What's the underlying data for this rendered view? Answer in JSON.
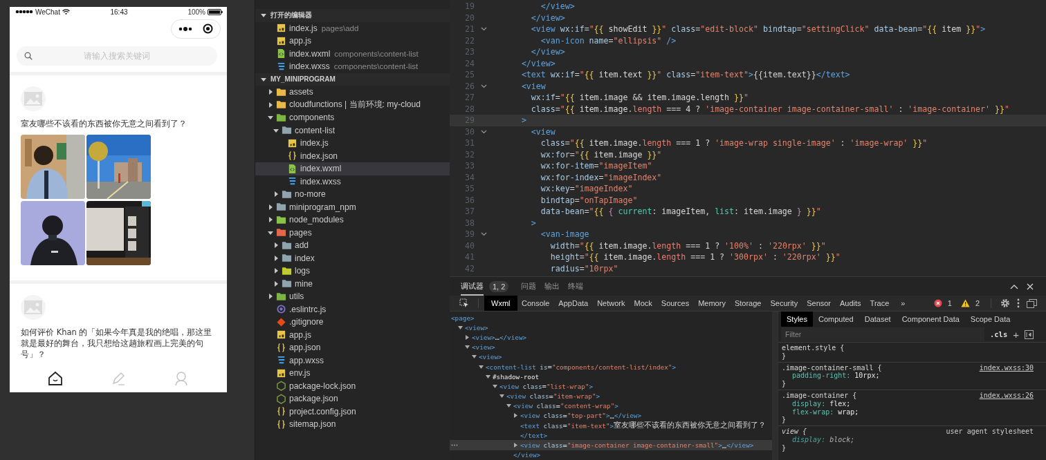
{
  "simulator": {
    "status_bar": {
      "carrier": "WeChat",
      "time": "16:43",
      "battery": "100%"
    },
    "search": {
      "placeholder": "请输入搜索关键词"
    },
    "posts": [
      {
        "text": "室友哪些不该看的东西被你无意之间看到了？"
      },
      {
        "text": "如何评价 Khan 的「如果今年真是我的绝唱，那这里就是最好的舞台，我只想给这趟旅程画上完美的句号」？"
      }
    ],
    "tab_bar": [
      {
        "selected": true
      },
      {
        "selected": false
      },
      {
        "selected": false
      }
    ]
  },
  "explorer": {
    "sections": [
      {
        "title": "打开的编辑器",
        "expanded": true,
        "items": [
          {
            "name": "index.js",
            "path": "pages\\add",
            "kind": "js"
          },
          {
            "name": "app.js",
            "kind": "js"
          },
          {
            "name": "index.wxml",
            "path": "components\\content-list",
            "kind": "wxml"
          },
          {
            "name": "index.wxss",
            "path": "components\\content-list",
            "kind": "wxss"
          }
        ]
      },
      {
        "title": "MY_MINIPROGRAM",
        "expanded": true,
        "items": [
          {
            "name": "assets",
            "kind": "folder",
            "color": "#e8b948",
            "expanded": false,
            "selected": false
          },
          {
            "name": "cloudfunctions | 当前环境: my-cloud",
            "kind": "folder",
            "color": "#e8b948",
            "expanded": false,
            "selected": false
          },
          {
            "name": "components",
            "kind": "folder",
            "color": "#7cb342",
            "expanded": true,
            "selected": false,
            "children": [
              {
                "name": "content-list",
                "kind": "folder",
                "color": "#90a4ae",
                "expanded": true,
                "selected": false,
                "children": [
                  {
                    "name": "index.js",
                    "kind": "js",
                    "selected": false
                  },
                  {
                    "name": "index.json",
                    "kind": "json",
                    "selected": false
                  },
                  {
                    "name": "index.wxml",
                    "kind": "wxml",
                    "selected": true
                  },
                  {
                    "name": "index.wxss",
                    "kind": "wxss",
                    "selected": false
                  }
                ]
              },
              {
                "name": "no-more",
                "kind": "folder",
                "color": "#90a4ae",
                "expanded": false,
                "selected": false
              }
            ]
          },
          {
            "name": "miniprogram_npm",
            "kind": "folder",
            "color": "#90a4ae",
            "expanded": false,
            "selected": false
          },
          {
            "name": "node_modules",
            "kind": "folder",
            "color": "#8bc34a",
            "expanded": false,
            "selected": false
          },
          {
            "name": "pages",
            "kind": "folder",
            "color": "#e5674a",
            "expanded": true,
            "selected": false,
            "children": [
              {
                "name": "add",
                "kind": "folder",
                "color": "#90a4ae",
                "expanded": false,
                "selected": false
              },
              {
                "name": "index",
                "kind": "folder",
                "color": "#90a4ae",
                "expanded": false,
                "selected": false
              },
              {
                "name": "logs",
                "kind": "folder",
                "color": "#c0ca33",
                "expanded": false,
                "selected": false
              },
              {
                "name": "mine",
                "kind": "folder",
                "color": "#90a4ae",
                "expanded": false,
                "selected": false
              }
            ]
          },
          {
            "name": "utils",
            "kind": "folder",
            "color": "#7cb342",
            "expanded": false,
            "selected": false
          },
          {
            "name": ".eslintrc.js",
            "kind": "eslint",
            "selected": false
          },
          {
            "name": ".gitignore",
            "kind": "git",
            "selected": false
          },
          {
            "name": "app.js",
            "kind": "js",
            "selected": false
          },
          {
            "name": "app.json",
            "kind": "json",
            "selected": false
          },
          {
            "name": "app.wxss",
            "kind": "wxss",
            "selected": false
          },
          {
            "name": "env.js",
            "kind": "js",
            "selected": false
          },
          {
            "name": "package-lock.json",
            "kind": "npm",
            "selected": false
          },
          {
            "name": "package.json",
            "kind": "npm",
            "selected": false
          },
          {
            "name": "project.config.json",
            "kind": "json",
            "selected": false
          },
          {
            "name": "sitemap.json",
            "kind": "json",
            "selected": false
          }
        ]
      }
    ]
  },
  "editor": {
    "lines": [
      {
        "number": "19",
        "foldable": false,
        "active": false,
        "tokens": [
          {
            "kind": "tag",
            "text": "          </view>"
          }
        ]
      },
      {
        "number": "20",
        "foldable": false,
        "active": false,
        "tokens": [
          {
            "kind": "tag",
            "text": "        </view>"
          }
        ]
      },
      {
        "number": "21",
        "foldable": true,
        "active": false,
        "tokens": [
          {
            "kind": "tag",
            "text": "        <view"
          },
          {
            "kind": "attr",
            "text": " wx:if"
          },
          {
            "kind": "plain",
            "text": "="
          },
          {
            "kind": "str",
            "text": "\""
          },
          {
            "kind": "brace",
            "text": "{{"
          },
          {
            "kind": "var",
            "text": " showEdit "
          },
          {
            "kind": "brace",
            "text": "}}"
          },
          {
            "kind": "str",
            "text": "\""
          },
          {
            "kind": "attr",
            "text": " class"
          },
          {
            "kind": "plain",
            "text": "="
          },
          {
            "kind": "str",
            "text": "\"edit-block\""
          },
          {
            "kind": "attr",
            "text": " bindtap"
          },
          {
            "kind": "plain",
            "text": "="
          },
          {
            "kind": "str",
            "text": "\"settingClick\""
          },
          {
            "kind": "attr",
            "text": " data-bean"
          },
          {
            "kind": "plain",
            "text": "="
          },
          {
            "kind": "str",
            "text": "\""
          },
          {
            "kind": "brace",
            "text": "{{"
          },
          {
            "kind": "var",
            "text": " item "
          },
          {
            "kind": "brace",
            "text": "}}"
          },
          {
            "kind": "str",
            "text": "\""
          },
          {
            "kind": "tag",
            "text": ">"
          }
        ]
      },
      {
        "number": "22",
        "foldable": false,
        "active": false,
        "tokens": [
          {
            "kind": "tag",
            "text": "          <van-icon"
          },
          {
            "kind": "attr",
            "text": " name"
          },
          {
            "kind": "plain",
            "text": "="
          },
          {
            "kind": "str",
            "text": "\"ellipsis\""
          },
          {
            "kind": "tag",
            "text": " />"
          }
        ]
      },
      {
        "number": "23",
        "foldable": false,
        "active": false,
        "tokens": [
          {
            "kind": "tag",
            "text": "        </view>"
          }
        ]
      },
      {
        "number": "24",
        "foldable": false,
        "active": false,
        "tokens": [
          {
            "kind": "tag",
            "text": "      </view>"
          }
        ]
      },
      {
        "number": "25",
        "foldable": false,
        "active": false,
        "tokens": [
          {
            "kind": "tag",
            "text": "      <text"
          },
          {
            "kind": "attr",
            "text": " wx:if"
          },
          {
            "kind": "plain",
            "text": "="
          },
          {
            "kind": "str",
            "text": "\""
          },
          {
            "kind": "brace",
            "text": "{{"
          },
          {
            "kind": "var",
            "text": " item.text "
          },
          {
            "kind": "brace",
            "text": "}}"
          },
          {
            "kind": "str",
            "text": "\""
          },
          {
            "kind": "attr",
            "text": " class"
          },
          {
            "kind": "plain",
            "text": "="
          },
          {
            "kind": "str",
            "text": "\"item-text\""
          },
          {
            "kind": "tag",
            "text": ">"
          },
          {
            "kind": "plain",
            "text": "{{item.text}}"
          },
          {
            "kind": "tag",
            "text": "</text>"
          }
        ]
      },
      {
        "number": "26",
        "foldable": true,
        "active": false,
        "tokens": [
          {
            "kind": "tag",
            "text": "      <view"
          }
        ]
      },
      {
        "number": "27",
        "foldable": false,
        "active": false,
        "tokens": [
          {
            "kind": "attr",
            "text": "        wx:if"
          },
          {
            "kind": "plain",
            "text": "="
          },
          {
            "kind": "str",
            "text": "\""
          },
          {
            "kind": "brace",
            "text": "{{"
          },
          {
            "kind": "var",
            "text": " item.image && item.image.length "
          },
          {
            "kind": "brace",
            "text": "}}"
          },
          {
            "kind": "str",
            "text": "\""
          }
        ]
      },
      {
        "number": "28",
        "foldable": false,
        "active": false,
        "tokens": [
          {
            "kind": "attr",
            "text": "        class"
          },
          {
            "kind": "plain",
            "text": "="
          },
          {
            "kind": "str",
            "text": "\""
          },
          {
            "kind": "brace",
            "text": "{{"
          },
          {
            "kind": "var",
            "text": " item.image."
          },
          {
            "kind": "prop",
            "text": "length"
          },
          {
            "kind": "var",
            "text": " === 4 ? "
          },
          {
            "kind": "str",
            "text": "'image-container image-container-small'"
          },
          {
            "kind": "var",
            "text": " : "
          },
          {
            "kind": "str",
            "text": "'image-container'"
          },
          {
            "kind": "brace",
            "text": " }}"
          },
          {
            "kind": "str",
            "text": "\""
          }
        ]
      },
      {
        "number": "29",
        "foldable": false,
        "active": true,
        "tokens": [
          {
            "kind": "tag",
            "text": "      >"
          }
        ]
      },
      {
        "number": "30",
        "foldable": true,
        "active": false,
        "tokens": [
          {
            "kind": "tag",
            "text": "        <view"
          }
        ]
      },
      {
        "number": "31",
        "foldable": false,
        "active": false,
        "tokens": [
          {
            "kind": "attr",
            "text": "          class"
          },
          {
            "kind": "plain",
            "text": "="
          },
          {
            "kind": "str",
            "text": "\""
          },
          {
            "kind": "brace",
            "text": "{{"
          },
          {
            "kind": "var",
            "text": " item.image."
          },
          {
            "kind": "prop",
            "text": "length"
          },
          {
            "kind": "var",
            "text": " === 1 ? "
          },
          {
            "kind": "str",
            "text": "'image-wrap single-image'"
          },
          {
            "kind": "var",
            "text": " : "
          },
          {
            "kind": "str",
            "text": "'image-wrap'"
          },
          {
            "kind": "brace",
            "text": " }}"
          },
          {
            "kind": "str",
            "text": "\""
          }
        ]
      },
      {
        "number": "32",
        "foldable": false,
        "active": false,
        "tokens": [
          {
            "kind": "attr",
            "text": "          wx:for"
          },
          {
            "kind": "plain",
            "text": "="
          },
          {
            "kind": "str",
            "text": "\""
          },
          {
            "kind": "brace",
            "text": "{{"
          },
          {
            "kind": "var",
            "text": " item.image "
          },
          {
            "kind": "brace",
            "text": "}}"
          },
          {
            "kind": "str",
            "text": "\""
          }
        ]
      },
      {
        "number": "33",
        "foldable": false,
        "active": false,
        "tokens": [
          {
            "kind": "attr",
            "text": "          wx:for-item"
          },
          {
            "kind": "plain",
            "text": "="
          },
          {
            "kind": "str",
            "text": "\"imageItem\""
          }
        ]
      },
      {
        "number": "34",
        "foldable": false,
        "active": false,
        "tokens": [
          {
            "kind": "attr",
            "text": "          wx:for-index"
          },
          {
            "kind": "plain",
            "text": "="
          },
          {
            "kind": "str",
            "text": "\"imageIndex\""
          }
        ]
      },
      {
        "number": "35",
        "foldable": false,
        "active": false,
        "tokens": [
          {
            "kind": "attr",
            "text": "          wx:key"
          },
          {
            "kind": "plain",
            "text": "="
          },
          {
            "kind": "str",
            "text": "\"imageIndex\""
          }
        ]
      },
      {
        "number": "36",
        "foldable": false,
        "active": false,
        "tokens": [
          {
            "kind": "attr",
            "text": "          bindtap"
          },
          {
            "kind": "plain",
            "text": "="
          },
          {
            "kind": "str",
            "text": "\"onTapImage\""
          }
        ]
      },
      {
        "number": "37",
        "foldable": false,
        "active": false,
        "tokens": [
          {
            "kind": "attr",
            "text": "          data-bean"
          },
          {
            "kind": "plain",
            "text": "="
          },
          {
            "kind": "str",
            "text": "\""
          },
          {
            "kind": "brace",
            "text": "{{"
          },
          {
            "kind": "inner",
            "text": " { "
          },
          {
            "kind": "key",
            "text": "current"
          },
          {
            "kind": "var",
            "text": ": imageItem, "
          },
          {
            "kind": "key",
            "text": "list"
          },
          {
            "kind": "var",
            "text": ": item.image "
          },
          {
            "kind": "inner",
            "text": "}"
          },
          {
            "kind": "brace",
            "text": " }}"
          },
          {
            "kind": "str",
            "text": "\""
          }
        ]
      },
      {
        "number": "38",
        "foldable": false,
        "active": false,
        "tokens": [
          {
            "kind": "tag",
            "text": "        >"
          }
        ]
      },
      {
        "number": "39",
        "foldable": true,
        "active": false,
        "tokens": [
          {
            "kind": "tag",
            "text": "          <van-image"
          }
        ]
      },
      {
        "number": "40",
        "foldable": false,
        "active": false,
        "tokens": [
          {
            "kind": "attr",
            "text": "            width"
          },
          {
            "kind": "plain",
            "text": "="
          },
          {
            "kind": "str",
            "text": "\""
          },
          {
            "kind": "brace",
            "text": "{{"
          },
          {
            "kind": "var",
            "text": " item.image."
          },
          {
            "kind": "prop",
            "text": "length"
          },
          {
            "kind": "var",
            "text": " === 1 ? "
          },
          {
            "kind": "str",
            "text": "'100%'"
          },
          {
            "kind": "var",
            "text": " : "
          },
          {
            "kind": "str",
            "text": "'220rpx'"
          },
          {
            "kind": "brace",
            "text": " }}"
          },
          {
            "kind": "str",
            "text": "\""
          }
        ]
      },
      {
        "number": "41",
        "foldable": false,
        "active": false,
        "tokens": [
          {
            "kind": "attr",
            "text": "            height"
          },
          {
            "kind": "plain",
            "text": "="
          },
          {
            "kind": "str",
            "text": "\""
          },
          {
            "kind": "brace",
            "text": "{{"
          },
          {
            "kind": "var",
            "text": " item.image."
          },
          {
            "kind": "prop",
            "text": "length"
          },
          {
            "kind": "var",
            "text": " === 1 ? "
          },
          {
            "kind": "str",
            "text": "'300rpx'"
          },
          {
            "kind": "var",
            "text": " : "
          },
          {
            "kind": "str",
            "text": "'220rpx'"
          },
          {
            "kind": "brace",
            "text": " }}"
          },
          {
            "kind": "str",
            "text": "\""
          }
        ]
      },
      {
        "number": "42",
        "foldable": false,
        "active": false,
        "tokens": [
          {
            "kind": "attr",
            "text": "            radius"
          },
          {
            "kind": "plain",
            "text": "="
          },
          {
            "kind": "str",
            "text": "\"10rpx\""
          }
        ]
      }
    ]
  },
  "debugger": {
    "tabs": [
      {
        "label": "调试器",
        "selected": true,
        "badge": "1, 2"
      },
      {
        "label": "问题",
        "selected": false
      },
      {
        "label": "输出",
        "selected": false
      },
      {
        "label": "终端",
        "selected": false
      }
    ],
    "panel_tabs": [
      {
        "label": "Wxml",
        "selected": true
      },
      {
        "label": "Console",
        "selected": false
      },
      {
        "label": "AppData",
        "selected": false
      },
      {
        "label": "Network",
        "selected": false
      },
      {
        "label": "Mock",
        "selected": false
      },
      {
        "label": "Sources",
        "selected": false
      },
      {
        "label": "Memory",
        "selected": false
      },
      {
        "label": "Storage",
        "selected": false
      },
      {
        "label": "Security",
        "selected": false
      },
      {
        "label": "Sensor",
        "selected": false
      },
      {
        "label": "Audits",
        "selected": false
      },
      {
        "label": "Trace",
        "selected": false
      }
    ],
    "overflow": "»",
    "errors": "1",
    "warnings": "2",
    "tree": [
      {
        "kind": "root",
        "selected": false,
        "tokens": [
          {
            "kind": "tag",
            "text": "<page>"
          }
        ],
        "children": [
          {
            "kind": "expandable",
            "expanded": true,
            "selected": false,
            "tokens": [
              {
                "kind": "tag",
                "text": "<view>"
              }
            ],
            "children": [
              {
                "kind": "expandable",
                "expanded": false,
                "selected": false,
                "tokens": [
                  {
                    "kind": "tag",
                    "text": "<view>"
                  },
                  {
                    "kind": "plain",
                    "text": "…"
                  },
                  {
                    "kind": "tag",
                    "text": "</view>"
                  }
                ]
              },
              {
                "kind": "expandable",
                "expanded": true,
                "selected": false,
                "tokens": [
                  {
                    "kind": "tag",
                    "text": "<view>"
                  }
                ],
                "children": [
                  {
                    "kind": "expandable",
                    "expanded": true,
                    "selected": false,
                    "tokens": [
                      {
                        "kind": "tag",
                        "text": "<view>"
                      }
                    ],
                    "children": [
                      {
                        "kind": "expandable",
                        "expanded": true,
                        "selected": false,
                        "tokens": [
                          {
                            "kind": "tag",
                            "text": "<content-list"
                          },
                          {
                            "kind": "attr",
                            "text": " is"
                          },
                          {
                            "kind": "plain",
                            "text": "="
                          },
                          {
                            "kind": "str",
                            "text": "\"components/content-list/index\""
                          },
                          {
                            "kind": "tag",
                            "text": ">"
                          }
                        ],
                        "children": [
                          {
                            "kind": "expandable",
                            "expanded": true,
                            "selected": false,
                            "tokens": [
                              {
                                "kind": "shadow",
                                "text": "#shadow-root"
                              }
                            ],
                            "children": [
                              {
                                "kind": "expandable",
                                "expanded": true,
                                "selected": false,
                                "tokens": [
                                  {
                                    "kind": "tag",
                                    "text": "<view"
                                  },
                                  {
                                    "kind": "attr",
                                    "text": " class"
                                  },
                                  {
                                    "kind": "plain",
                                    "text": "="
                                  },
                                  {
                                    "kind": "str",
                                    "text": "\"list-wrap\""
                                  },
                                  {
                                    "kind": "tag",
                                    "text": ">"
                                  }
                                ],
                                "children": [
                                  {
                                    "kind": "expandable",
                                    "expanded": true,
                                    "selected": false,
                                    "tokens": [
                                      {
                                        "kind": "tag",
                                        "text": "<view"
                                      },
                                      {
                                        "kind": "attr",
                                        "text": " class"
                                      },
                                      {
                                        "kind": "plain",
                                        "text": "="
                                      },
                                      {
                                        "kind": "str",
                                        "text": "\"item-wrap\""
                                      },
                                      {
                                        "kind": "tag",
                                        "text": ">"
                                      }
                                    ],
                                    "children": [
                                      {
                                        "kind": "expandable",
                                        "expanded": true,
                                        "selected": false,
                                        "tokens": [
                                          {
                                            "kind": "tag",
                                            "text": "<view"
                                          },
                                          {
                                            "kind": "attr",
                                            "text": " class"
                                          },
                                          {
                                            "kind": "plain",
                                            "text": "="
                                          },
                                          {
                                            "kind": "str",
                                            "text": "\"content-wrap\""
                                          },
                                          {
                                            "kind": "tag",
                                            "text": ">"
                                          }
                                        ],
                                        "children": [
                                          {
                                            "kind": "expandable",
                                            "expanded": false,
                                            "selected": false,
                                            "tokens": [
                                              {
                                                "kind": "tag",
                                                "text": "<view"
                                              },
                                              {
                                                "kind": "attr",
                                                "text": " class"
                                              },
                                              {
                                                "kind": "plain",
                                                "text": "="
                                              },
                                              {
                                                "kind": "str",
                                                "text": "\"top-part\""
                                              },
                                              {
                                                "kind": "tag",
                                                "text": ">"
                                              },
                                              {
                                                "kind": "plain",
                                                "text": "…"
                                              },
                                              {
                                                "kind": "tag",
                                                "text": "</view>"
                                              }
                                            ]
                                          },
                                          {
                                            "kind": "leaf",
                                            "selected": false,
                                            "tokens": [
                                              {
                                                "kind": "tag",
                                                "text": "<text"
                                              },
                                              {
                                                "kind": "attr",
                                                "text": " class"
                                              },
                                              {
                                                "kind": "plain",
                                                "text": "="
                                              },
                                              {
                                                "kind": "str",
                                                "text": "\"item-text\""
                                              },
                                              {
                                                "kind": "tag",
                                                "text": ">"
                                              },
                                              {
                                                "kind": "plain",
                                                "text": "室友哪些不该看的东西被你无意之间看到了？"
                                              }
                                            ]
                                          },
                                          {
                                            "kind": "leaf",
                                            "selected": false,
                                            "tokens": [
                                              {
                                                "kind": "tag",
                                                "text": "</text>"
                                              }
                                            ]
                                          },
                                          {
                                            "kind": "expandable",
                                            "expanded": false,
                                            "selected": true,
                                            "tokens": [
                                              {
                                                "kind": "tag",
                                                "text": "<view"
                                              },
                                              {
                                                "kind": "attr",
                                                "text": " class"
                                              },
                                              {
                                                "kind": "plain",
                                                "text": "="
                                              },
                                              {
                                                "kind": "str",
                                                "text": "\"image-container image-container-small\""
                                              },
                                              {
                                                "kind": "tag",
                                                "text": ">"
                                              },
                                              {
                                                "kind": "plain",
                                                "text": "…"
                                              },
                                              {
                                                "kind": "tag",
                                                "text": "</view>"
                                              }
                                            ]
                                          }
                                        ]
                                      },
                                      {
                                        "kind": "leaf",
                                        "selected": false,
                                        "tokens": [
                                          {
                                            "kind": "tag",
                                            "text": "</view>"
                                          }
                                        ]
                                      }
                                    ]
                                  }
                                ]
                              }
                            ]
                          }
                        ]
                      }
                    ]
                  }
                ]
              }
            ]
          }
        ]
      }
    ],
    "styles": {
      "tabs": [
        {
          "label": "Styles",
          "selected": true
        },
        {
          "label": "Computed",
          "selected": false
        },
        {
          "label": "Dataset",
          "selected": false
        },
        {
          "label": "Component Data",
          "selected": false
        },
        {
          "label": "Scope Data",
          "selected": false
        }
      ],
      "filter": {
        "placeholder": "Filter"
      },
      "cls": ".cls",
      "add": "+",
      "rules": [
        {
          "kind": "inline",
          "selector": "element.style {",
          "close": "}"
        },
        {
          "kind": "author",
          "selector": ".image-container-small {",
          "source": "index.wxss:30",
          "close": "}",
          "declarations": [
            {
              "property": "padding-right:",
              "value": "10rpx;",
              "overridden": false
            }
          ]
        },
        {
          "kind": "author",
          "selector": ".image-container {",
          "source": "index.wxss:26",
          "close": "}",
          "declarations": [
            {
              "property": "display:",
              "value": "flex;",
              "overridden": false
            },
            {
              "property": "flex-wrap:",
              "value": "wrap;",
              "overridden": false
            }
          ]
        },
        {
          "kind": "user-agent",
          "selector": "view {",
          "source": "user agent stylesheet",
          "close": "}",
          "declarations": [
            {
              "property": "display:",
              "value": "block;",
              "overridden": true
            }
          ]
        }
      ]
    }
  }
}
